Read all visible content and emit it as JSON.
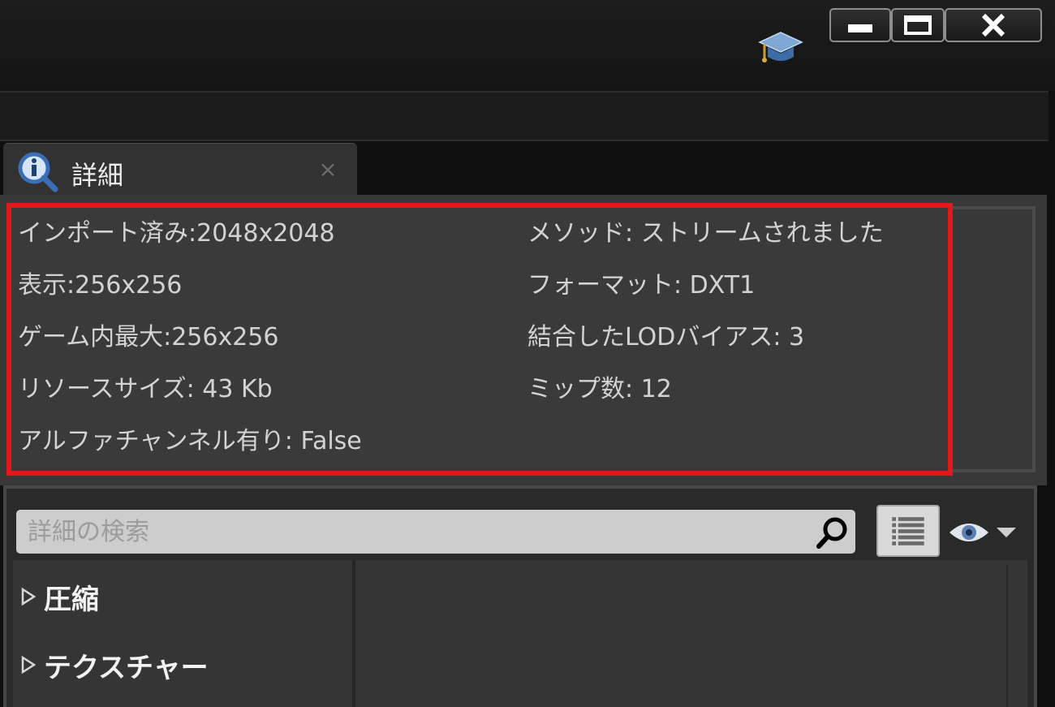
{
  "window": {
    "buttons": [
      "minimize",
      "maximize",
      "close"
    ],
    "icons": {
      "academy": "graduation-cap-icon",
      "close": "x-icon"
    }
  },
  "tab": {
    "label": "詳細",
    "icon": "details-info-magnifier-icon",
    "close_glyph": "×"
  },
  "texture_info": {
    "left": [
      "インポート済み:2048x2048",
      "表示:256x256",
      "ゲーム内最大:256x256",
      "リソースサイズ: 43 Kb",
      "アルファチャンネル有り: False"
    ],
    "right": [
      "メソッド: ストリームされました",
      "フォーマット: DXT1",
      "結合したLODバイアス: 3",
      "ミップ数: 12"
    ]
  },
  "search": {
    "placeholder": "詳細の検索",
    "value": ""
  },
  "categories": [
    {
      "label": "圧縮"
    },
    {
      "label": "テクスチャー"
    }
  ],
  "colors": {
    "highlight": "#e3181b",
    "panel": "#383838",
    "background": "#0f0f0f"
  }
}
